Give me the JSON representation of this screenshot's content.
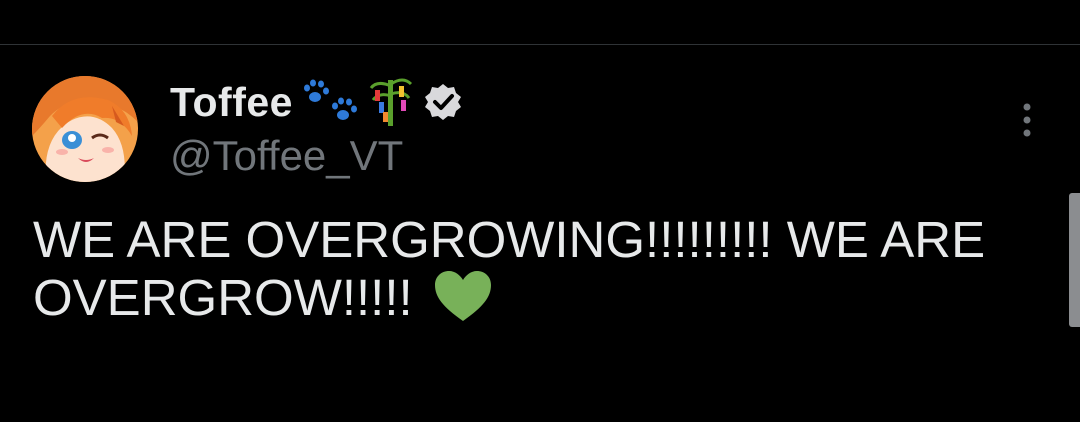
{
  "tweet": {
    "author": {
      "display_name": "Toffee",
      "handle": "@Toffee_VT",
      "name_emojis": [
        "paw-prints-emoji",
        "tanabata-tree-emoji"
      ],
      "verified": true,
      "avatar": "anime-avatar-orange-hair"
    },
    "text": "WE ARE OVERGROWING!!!!!!!!! WE ARE OVERGROW!!!!!",
    "text_emoji": "green-heart-emoji",
    "menu_icon": "more-vertical-icon"
  },
  "colors": {
    "background": "#000000",
    "text_primary": "#e7e9ea",
    "text_secondary": "#71767b",
    "divider": "#2f3336",
    "verified_badge": "#d9d9dc",
    "heart": "#78b159"
  }
}
